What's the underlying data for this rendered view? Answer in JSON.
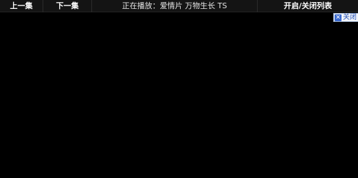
{
  "toolbar": {
    "prev_label": "上一集",
    "next_label": "下一集",
    "now_playing": "正在播放：爱情片 万物生长 TS",
    "toggle_list_label": "开启/关闭列表"
  },
  "close_tag": {
    "icon": "close-x-icon",
    "icon_glyph": "✕",
    "label": "关闭"
  },
  "colors": {
    "toolbar_bg": "#141414",
    "page_bg": "#000000",
    "close_accent": "#3a6ad0"
  }
}
